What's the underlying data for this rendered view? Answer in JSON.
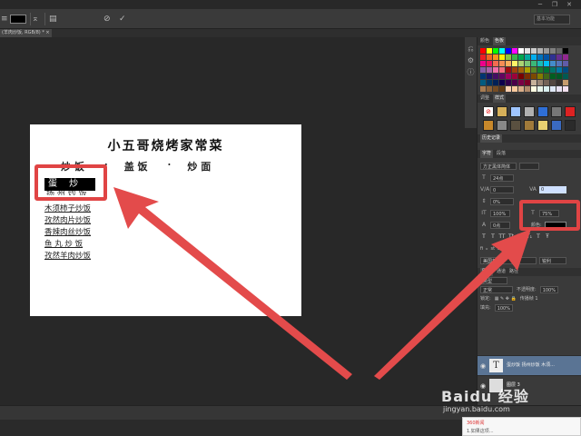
{
  "tab": {
    "title": "(羊肉炒饭, RGB/8) *"
  },
  "options": {
    "workspace": "基本功能"
  },
  "document": {
    "title": "小五哥烧烤家常菜",
    "categories": [
      "炒 饭",
      "·",
      "盖 饭",
      "·",
      "炒 面"
    ],
    "selected_item": "蛋 炒 饭",
    "peek_item": "扬 州 炒 饭",
    "menu_items": [
      "木须柿子炒饭",
      "孜然肉片炒饭",
      "香辣肉丝炒饭",
      "鱼 丸 炒 饭",
      "孜然羊肉炒饭"
    ]
  },
  "panels": {
    "color_tabs": [
      "颜色",
      "色板"
    ],
    "style_tabs": [
      "调整",
      "样式"
    ],
    "history_tab": "历史记录",
    "char_tabs": [
      "字符",
      "段落"
    ],
    "font_family": "方正黑体简体",
    "font_size": "24点",
    "leading": "0",
    "tracking": "0%",
    "kerning": "0",
    "vscale": "100%",
    "hscale": "75%",
    "baseline": "0点",
    "color_label": "颜色:",
    "language": "美国英语",
    "antialias": "锐利",
    "layer_tabs": [
      "图层",
      "通道",
      "路径"
    ],
    "layer_filter": "类型",
    "blend_mode": "正常",
    "opacity_label": "不透明度:",
    "opacity": "100%",
    "lock_label": "锁定:",
    "fill_label": "填充:",
    "fill": "100%",
    "propagate": "传播帧 1",
    "layers": [
      {
        "name": "蛋炒饭 扬州炒饭 木须...",
        "thumb": "T"
      },
      {
        "name": "图层 3",
        "thumb": ""
      }
    ],
    "swatch_colors": [
      "#ff0000",
      "#ffff00",
      "#00ff00",
      "#00ffff",
      "#0000ff",
      "#ff00ff",
      "#ffffff",
      "#e6e6e6",
      "#cccccc",
      "#b3b3b3",
      "#999999",
      "#808080",
      "#666666",
      "#000000",
      "#ee1d24",
      "#f26522",
      "#f7941d",
      "#fff200",
      "#8dc63f",
      "#39b54a",
      "#00a651",
      "#00a99d",
      "#00aeef",
      "#0072bc",
      "#0054a6",
      "#2e3192",
      "#662d91",
      "#92278f",
      "#ec008c",
      "#ed145b",
      "#f26c4f",
      "#f68e55",
      "#fbaf5c",
      "#fff467",
      "#acd372",
      "#7cc576",
      "#3bb878",
      "#1abbb4",
      "#00bff3",
      "#438cca",
      "#5574b9",
      "#605ca8",
      "#855fa8",
      "#a763a8",
      "#f06ea9",
      "#f26d7d",
      "#9e0b0f",
      "#a0410d",
      "#a3620a",
      "#aba000",
      "#598527",
      "#197b30",
      "#007236",
      "#00746b",
      "#0076a3",
      "#004b80",
      "#003471",
      "#1b1464",
      "#440e62",
      "#630460",
      "#9e005d",
      "#9e0039",
      "#790000",
      "#7b2e00",
      "#7d4900",
      "#827b00",
      "#406618",
      "#005e20",
      "#005826",
      "#005952",
      "#005b7f",
      "#003663",
      "#002157",
      "#0d004c",
      "#32004b",
      "#4b0049",
      "#7b0046",
      "#7a0026",
      "#c7b299",
      "#998675",
      "#736357",
      "#534741",
      "#37302d",
      "#c69c6d",
      "#a67c52",
      "#8c6239",
      "#754c24",
      "#603913",
      "#fdd0b1",
      "#f8c99d",
      "#d9ae89",
      "#b18a6b",
      "#fffde0",
      "#e6f4ea",
      "#d8efef",
      "#dfe8f6",
      "#e7e0f1",
      "#f4e0ef"
    ]
  },
  "popup": {
    "title": "360新闻",
    "text": "1.如果这项..."
  },
  "watermark": {
    "brand": "Baidu 经验",
    "sub": "jingyan.baidu.com"
  }
}
